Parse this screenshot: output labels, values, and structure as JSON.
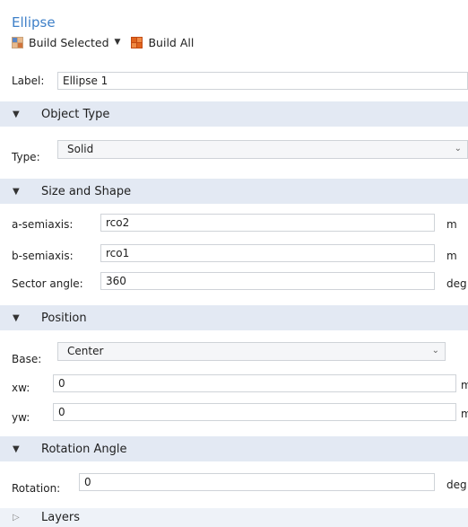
{
  "header": {
    "title": "Ellipse",
    "build_selected_label": "Build Selected",
    "build_all_label": "Build All"
  },
  "label_field": {
    "label": "Label:",
    "value": "Ellipse 1"
  },
  "sections": {
    "object_type": {
      "title": "Object Type",
      "type_label": "Type:",
      "type_value": "Solid"
    },
    "size_and_shape": {
      "title": "Size and Shape",
      "a_semiaxis_label": "a-semiaxis:",
      "a_semiaxis_value": "rco2",
      "a_semiaxis_unit": "m",
      "b_semiaxis_label": "b-semiaxis:",
      "b_semiaxis_value": "rco1",
      "b_semiaxis_unit": "m",
      "sector_angle_label": "Sector angle:",
      "sector_angle_value": "360",
      "sector_angle_unit": "deg"
    },
    "position": {
      "title": "Position",
      "base_label": "Base:",
      "base_value": "Center",
      "xw_label": "xw:",
      "xw_value": "0",
      "xw_unit": "m",
      "yw_label": "yw:",
      "yw_value": "0",
      "yw_unit": "m"
    },
    "rotation_angle": {
      "title": "Rotation Angle",
      "rotation_label": "Rotation:",
      "rotation_value": "0",
      "rotation_unit": "deg"
    },
    "layers": {
      "title": "Layers"
    }
  },
  "icons": {
    "expanded": "triangle-down-icon",
    "collapsed": "triangle-right-icon",
    "dropdown": "chevron-down-icon",
    "build_selected": "build-selected-icon",
    "build_all": "build-all-icon"
  },
  "colors": {
    "title": "#3f80c8",
    "section_bg": "#e3e9f3",
    "build_all_icon": "#e0641e"
  }
}
